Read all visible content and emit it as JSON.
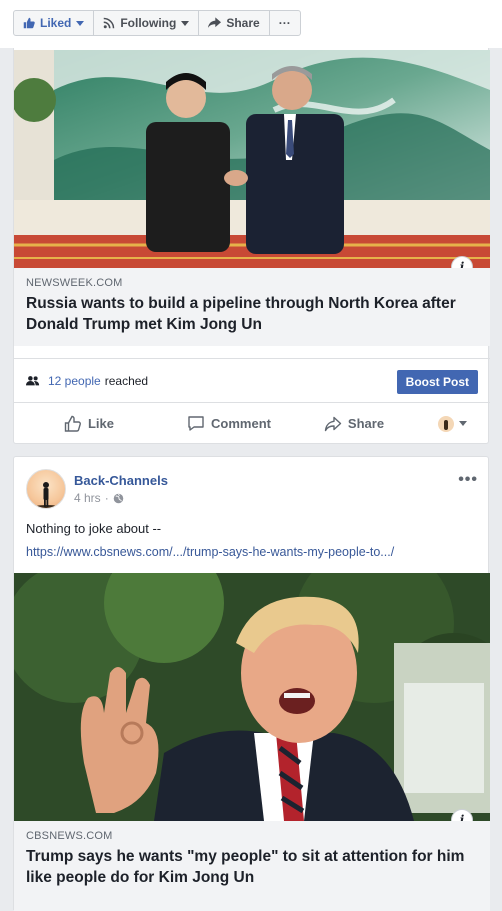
{
  "toolbar": {
    "liked_label": "Liked",
    "following_label": "Following",
    "share_label": "Share",
    "more_label": "···"
  },
  "post1": {
    "link": {
      "domain": "NEWSWEEK.COM",
      "headline": "Russia wants to build a pipeline through North Korea after Donald Trump met Kim Jong Un"
    },
    "reach": {
      "count": "12 people",
      "suffix": "reached"
    },
    "boost_label": "Boost Post",
    "actions": {
      "like": "Like",
      "comment": "Comment",
      "share": "Share"
    }
  },
  "post2": {
    "author": "Back-Channels",
    "time": "4 hrs",
    "separator": "·",
    "more": "•••",
    "text": "Nothing to joke about --",
    "url": "https://www.cbsnews.com/.../trump-says-he-wants-my-people-to.../",
    "link": {
      "domain": "CBSNEWS.COM",
      "headline": "Trump says he wants \"my people\" to sit at attention for him like people do for Kim Jong Un"
    }
  },
  "info_badge": "i"
}
